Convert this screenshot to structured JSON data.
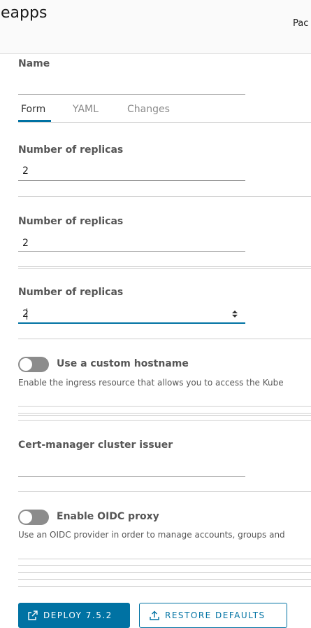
{
  "header": {
    "app_title": "eapps",
    "right_text": "Pac"
  },
  "form": {
    "name_label": "Name",
    "name_value": ""
  },
  "tabs": [
    {
      "label": "Form",
      "active": true
    },
    {
      "label": "YAML",
      "active": false
    },
    {
      "label": "Changes",
      "active": false
    }
  ],
  "replicas": [
    {
      "label": "Number of replicas",
      "value": "2"
    },
    {
      "label": "Number of replicas",
      "value": "2"
    },
    {
      "label": "Number of replicas",
      "value": "2"
    }
  ],
  "hostname_toggle": {
    "label": "Use a custom hostname",
    "description": "Enable the ingress resource that allows you to access the Kube",
    "enabled": false
  },
  "cert_manager": {
    "label": "Cert-manager cluster issuer",
    "value": ""
  },
  "oidc_toggle": {
    "label": "Enable OIDC proxy",
    "description": "Use an OIDC provider in order to manage accounts, groups and",
    "enabled": false
  },
  "buttons": {
    "deploy": "DEPLOY 7.5.2",
    "restore": "RESTORE DEFAULTS"
  },
  "colors": {
    "accent": "#0072a3",
    "toggle_off": "#8c8c8c"
  }
}
